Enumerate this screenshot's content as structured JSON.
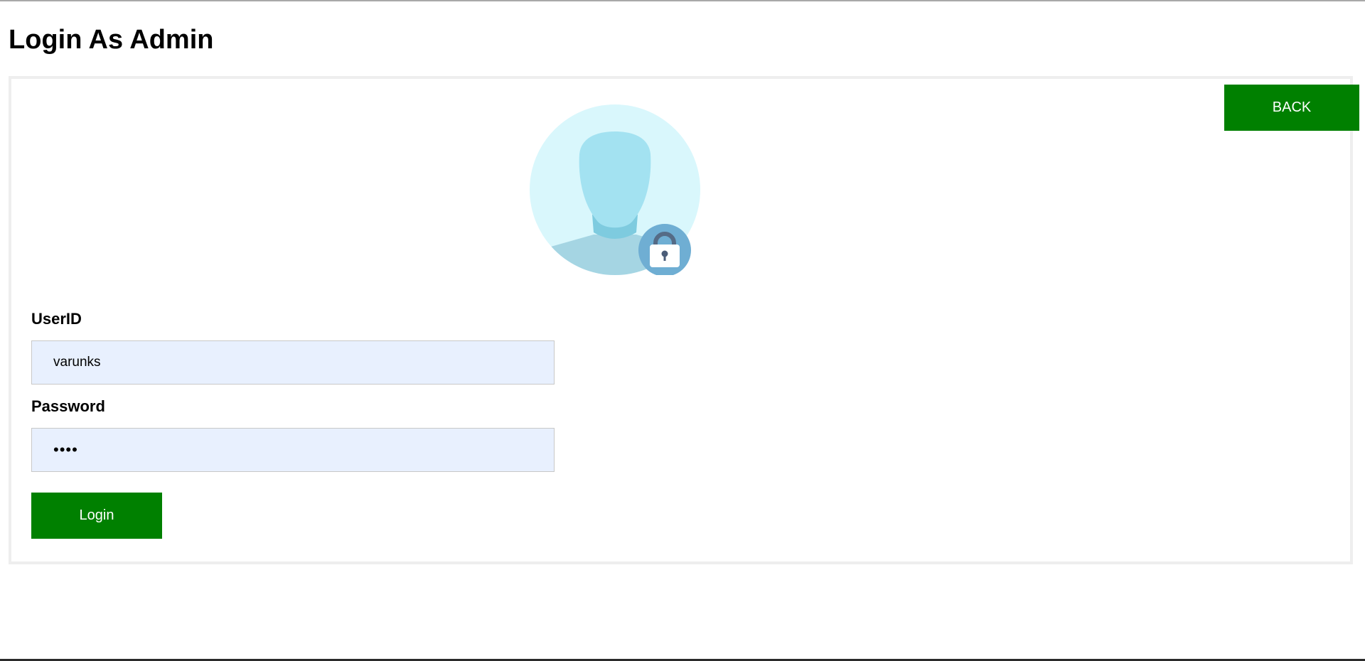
{
  "page": {
    "title": "Login As Admin"
  },
  "header": {
    "back_label": "BACK"
  },
  "form": {
    "userid_label": "UserID",
    "userid_value": "varunks",
    "password_label": "Password",
    "password_value": "••••",
    "login_label": "Login"
  },
  "icons": {
    "avatar": "admin-avatar-lock-icon"
  },
  "colors": {
    "button_green": "#008000",
    "input_fill": "#e8f0fe",
    "avatar_circle": "#d9f7fc",
    "avatar_head": "#a3e2f1",
    "avatar_shoulders": "#a5d5e3",
    "lock_badge": "#6faed3"
  }
}
